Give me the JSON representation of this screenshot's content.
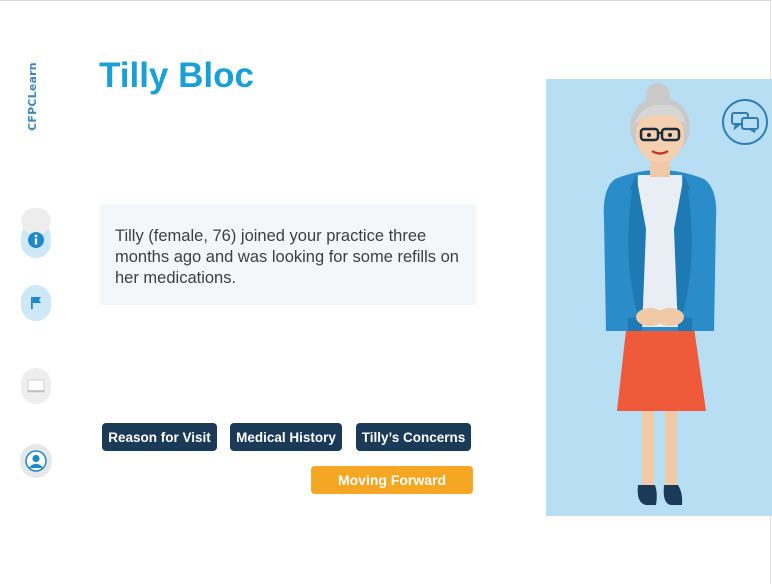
{
  "brand": {
    "logo_text": "CFPCLearn"
  },
  "header": {
    "title": "Tilly Bloc"
  },
  "intro": {
    "text": "Tilly (female, 76) joined your practice three months ago and was looking for some refills on her medications."
  },
  "tabs": [
    {
      "label": "Reason for Visit"
    },
    {
      "label": "Medical History"
    },
    {
      "label": "Tilly’s Concerns"
    }
  ],
  "cta": {
    "label": "Moving Forward"
  },
  "sidebar": {
    "icons": [
      "info-icon",
      "flag-icon",
      "note-icon",
      "user-icon"
    ]
  },
  "colors": {
    "title": "#1aa0d6",
    "tab_bg": "#1b3a58",
    "cta_bg": "#f5a623",
    "portrait_bg": "#b8def4",
    "sidebar_active": "#cfe8f7"
  }
}
